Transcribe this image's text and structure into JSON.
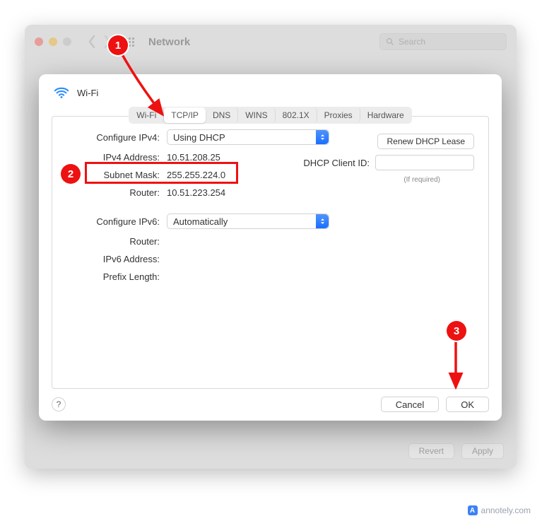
{
  "window": {
    "title": "Network",
    "search_placeholder": "Search"
  },
  "sheet": {
    "title": "Wi-Fi",
    "tabs": [
      "Wi-Fi",
      "TCP/IP",
      "DNS",
      "WINS",
      "802.1X",
      "Proxies",
      "Hardware"
    ],
    "ipv4": {
      "configure_label": "Configure IPv4:",
      "configure_value": "Using DHCP",
      "address_label": "IPv4 Address:",
      "address_value": "10.51.208.25",
      "subnet_label": "Subnet Mask:",
      "subnet_value": "255.255.224.0",
      "router_label": "Router:",
      "router_value": "10.51.223.254"
    },
    "dhcp": {
      "renew_label": "Renew DHCP Lease",
      "client_id_label": "DHCP Client ID:",
      "required_note": "(If required)"
    },
    "ipv6": {
      "configure_label": "Configure IPv6:",
      "configure_value": "Automatically",
      "router_label": "Router:",
      "address_label": "IPv6 Address:",
      "prefix_label": "Prefix Length:"
    },
    "help_label": "?",
    "cancel_label": "Cancel",
    "ok_label": "OK"
  },
  "window_footer": {
    "revert_label": "Revert",
    "apply_label": "Apply"
  },
  "annotations": {
    "badge1": "1",
    "badge2": "2",
    "badge3": "3"
  },
  "watermark": "annotely.com"
}
